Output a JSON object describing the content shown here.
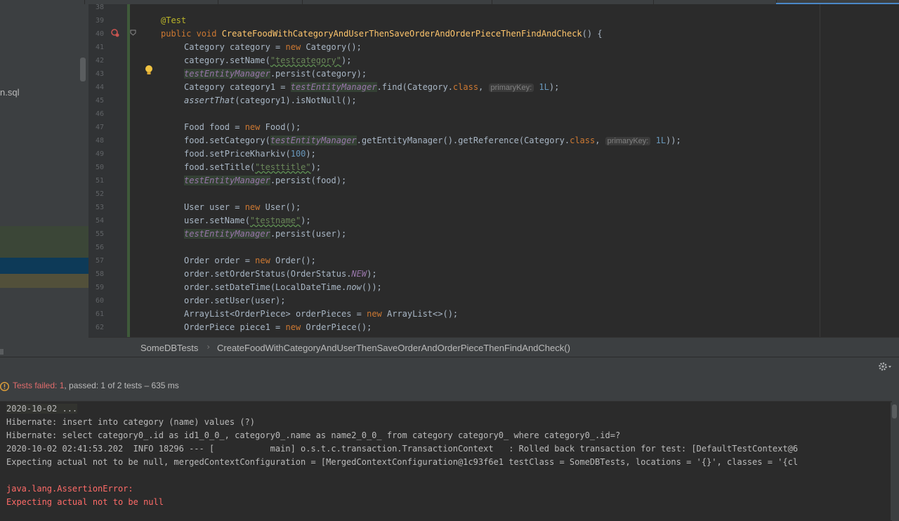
{
  "colors": {
    "keyword": "#cc7832",
    "string": "#6a8759",
    "number": "#6897bb",
    "method_decl": "#ffc66d",
    "field": "#9876aa",
    "annotation": "#bbb529",
    "error_text": "#ff6b68",
    "failed_status": "#e06c6c",
    "active_tab": "#4a88c7"
  },
  "sidebar": {
    "file_label": "n.sql"
  },
  "editor": {
    "line_numbers": [
      "38",
      "39",
      "40",
      "41",
      "42",
      "43",
      "44",
      "45",
      "46",
      "47",
      "48",
      "49",
      "50",
      "51",
      "52",
      "53",
      "54",
      "55",
      "56",
      "57",
      "58",
      "59",
      "60",
      "61",
      "62"
    ],
    "hint_primary_key": "primaryKey:",
    "lines": {
      "l39": "@Test",
      "l40_kw": "public void ",
      "l40_fn": "CreateFoodWithCategoryAndUserThenSaveOrderAndOrderPieceThenFindAndCheck",
      "l40_end": "() {",
      "l41_a": "Category category = ",
      "l41_kw": "new ",
      "l41_b": "Category();",
      "l42_a": "category.setName(",
      "l42_str": "\"testcategory\"",
      "l42_b": ");",
      "l43_field": "testEntityManager",
      "l43_b": ".persist(category);",
      "l44_a": "Category category1 = ",
      "l44_field": "testEntityManager",
      "l44_b": ".find(Category.",
      "l44_kw": "class",
      "l44_c": ", ",
      "l44_num": "1L",
      "l44_d": ");",
      "l45_it": "assertThat",
      "l45_b": "(category1).isNotNull();",
      "l47_a": "Food food = ",
      "l47_kw": "new ",
      "l47_b": "Food();",
      "l48_a": "food.setCategory(",
      "l48_field": "testEntityManager",
      "l48_b": ".getEntityManager().getReference(Category.",
      "l48_kw": "class",
      "l48_c": ", ",
      "l48_num": "1L",
      "l48_d": "));",
      "l49_a": "food.setPriceKharkiv(",
      "l49_num": "100",
      "l49_b": ");",
      "l50_a": "food.setTitle(",
      "l50_str": "\"testtitle\"",
      "l50_b": ");",
      "l51_field": "testEntityManager",
      "l51_b": ".persist(food);",
      "l53_a": "User user = ",
      "l53_kw": "new ",
      "l53_b": "User();",
      "l54_a": "user.setName(",
      "l54_str": "\"testname\"",
      "l54_b": ");",
      "l55_field": "testEntityManager",
      "l55_b": ".persist(user);",
      "l57_a": "Order order = ",
      "l57_kw": "new ",
      "l57_b": "Order();",
      "l58_a": "order.setOrderStatus(OrderStatus.",
      "l58_field": "NEW",
      "l58_b": ");",
      "l59_a": "order.setDateTime(LocalDateTime.",
      "l59_it": "now",
      "l59_b": "());",
      "l60_a": "order.setUser(user);",
      "l61_a": "ArrayList<OrderPiece> orderPieces = ",
      "l61_kw": "new ",
      "l61_b": "ArrayList<>();",
      "l62_a": "OrderPiece piece1 = ",
      "l62_kw": "new ",
      "l62_b": "OrderPiece();"
    }
  },
  "breadcrumb": {
    "class_name": "SomeDBTests",
    "method_name": "CreateFoodWithCategoryAndUserThenSaveOrderAndOrderPieceThenFindAndCheck()"
  },
  "run_panel": {
    "status_failed": "Tests failed: 1",
    "status_rest": ", passed: 1 of 2 tests – 635 ms",
    "console_lines": [
      "2020-10-02 ...",
      "Hibernate: insert into category (name) values (?)",
      "Hibernate: select category0_.id as id1_0_0_, category0_.name as name2_0_0_ from category category0_ where category0_.id=?",
      "2020-10-02 02:41:53.202  INFO 18296 --- [           main] o.s.t.c.transaction.TransactionContext   : Rolled back transaction for test: [DefaultTestContext@6",
      "Expecting actual not to be null, mergedContextConfiguration = [MergedContextConfiguration@1c93f6e1 testClass = SomeDBTests, locations = '{}', classes = '{cl",
      "",
      "java.lang.AssertionError:",
      "Expecting actual not to be null"
    ]
  }
}
